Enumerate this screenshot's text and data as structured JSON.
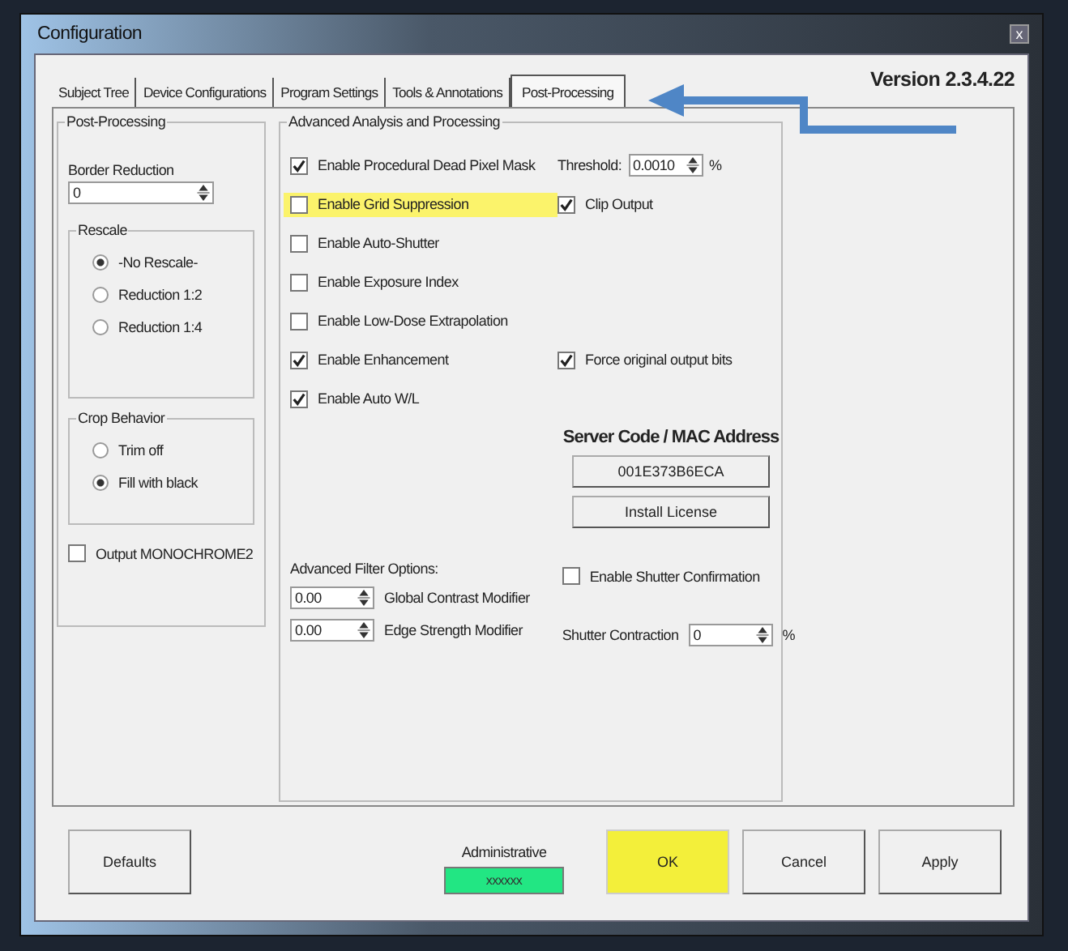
{
  "window": {
    "title": "Configuration",
    "close": "x"
  },
  "version": "Version 2.3.4.22",
  "tabs": [
    {
      "label": "Subject Tree",
      "selected": false
    },
    {
      "label": "Device Configurations",
      "selected": false
    },
    {
      "label": "Program Settings",
      "selected": false
    },
    {
      "label": "Tools & Annotations",
      "selected": false
    },
    {
      "label": "Post-Processing",
      "selected": true
    }
  ],
  "post_processing": {
    "title": "Post-Processing",
    "border_reduction": {
      "label": "Border Reduction",
      "value": "0"
    },
    "rescale": {
      "title": "Rescale",
      "options": [
        {
          "label": "-No Rescale-",
          "selected": true
        },
        {
          "label": "Reduction 1:2",
          "selected": false
        },
        {
          "label": "Reduction 1:4",
          "selected": false
        }
      ]
    },
    "crop_behavior": {
      "title": "Crop Behavior",
      "options": [
        {
          "label": "Trim off",
          "selected": false
        },
        {
          "label": "Fill with black",
          "selected": true
        }
      ]
    },
    "output_monochrome2": {
      "label": "Output MONOCHROME2",
      "checked": false
    }
  },
  "advanced": {
    "title": "Advanced Analysis and Processing",
    "rows": [
      {
        "cells": [
          {
            "kind": "checkbox",
            "label": "Enable Procedural Dead Pixel Mask",
            "checked": true,
            "highlighted": false
          },
          {
            "kind": "spin",
            "label": "Threshold:",
            "value": "0.0010",
            "unit": "%"
          }
        ]
      },
      {
        "cells": [
          {
            "kind": "checkbox",
            "label": "Enable Grid Suppression",
            "checked": false,
            "highlighted": true
          },
          {
            "kind": "checkbox",
            "label": "Clip Output",
            "checked": true,
            "highlighted": false
          }
        ]
      },
      {
        "cells": [
          {
            "kind": "checkbox",
            "label": "Enable Auto-Shutter",
            "checked": false,
            "highlighted": false
          }
        ]
      },
      {
        "cells": [
          {
            "kind": "checkbox",
            "label": "Enable Exposure Index",
            "checked": false,
            "highlighted": false
          }
        ]
      },
      {
        "cells": [
          {
            "kind": "checkbox",
            "label": "Enable Low-Dose Extrapolation",
            "checked": false,
            "highlighted": false
          }
        ]
      },
      {
        "cells": [
          {
            "kind": "checkbox",
            "label": "Enable Enhancement",
            "checked": true,
            "highlighted": false
          },
          {
            "kind": "checkbox",
            "label": "Force original output bits",
            "checked": true,
            "highlighted": false
          }
        ]
      },
      {
        "cells": [
          {
            "kind": "checkbox",
            "label": "Enable Auto W/L",
            "checked": true,
            "highlighted": false
          }
        ]
      }
    ],
    "server": {
      "heading": "Server Code / MAC Address",
      "code": "001E373B6ECA",
      "install": "Install License"
    },
    "filters": {
      "title": "Advanced Filter Options:",
      "fields": [
        {
          "value": "0.00",
          "label": "Global Contrast Modifier"
        },
        {
          "value": "0.00",
          "label": "Edge Strength Modifier"
        }
      ]
    },
    "shutter_confirmation": {
      "label": "Enable Shutter Confirmation",
      "checked": false
    },
    "shutter_contraction": {
      "label": "Shutter Contraction",
      "value": "0",
      "unit": "%"
    }
  },
  "footer": {
    "defaults": "Defaults",
    "admin": {
      "label": "Administrative",
      "value": "xxxxxx"
    },
    "buttons": [
      {
        "label": "OK",
        "highlighted": true
      },
      {
        "label": "Cancel",
        "highlighted": false
      },
      {
        "label": "Apply",
        "highlighted": false
      }
    ]
  }
}
